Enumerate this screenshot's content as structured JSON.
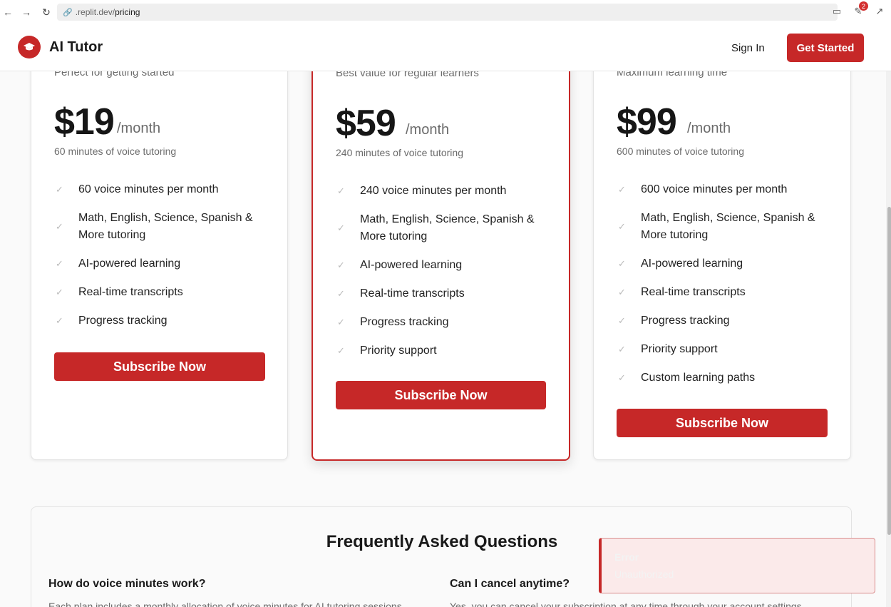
{
  "browser": {
    "url_domain": ".replit.dev/",
    "url_path": "pricing",
    "extensions_badge": "2"
  },
  "header": {
    "brand": "AI Tutor",
    "sign_in": "Sign In",
    "get_started": "Get Started"
  },
  "plans": [
    {
      "description": "Perfect for getting started",
      "price": "$19",
      "period": "/month",
      "minutes": "60 minutes of voice tutoring",
      "features": [
        "60 voice minutes per month",
        "Math, English, Science, Spanish & More tutoring",
        "AI-powered learning",
        "Real-time transcripts",
        "Progress tracking"
      ],
      "cta": "Subscribe Now"
    },
    {
      "description": "Best value for regular learners",
      "price": "$59",
      "period": "/month",
      "minutes": "240 minutes of voice tutoring",
      "features": [
        "240 voice minutes per month",
        "Math, English, Science, Spanish & More tutoring",
        "AI-powered learning",
        "Real-time transcripts",
        "Progress tracking",
        "Priority support"
      ],
      "cta": "Subscribe Now"
    },
    {
      "description": "Maximum learning time",
      "price": "$99",
      "period": "/month",
      "minutes": "600 minutes of voice tutoring",
      "features": [
        "600 voice minutes per month",
        "Math, English, Science, Spanish & More tutoring",
        "AI-powered learning",
        "Real-time transcripts",
        "Progress tracking",
        "Priority support",
        "Custom learning paths"
      ],
      "cta": "Subscribe Now"
    }
  ],
  "faq": {
    "title": "Frequently Asked Questions",
    "items": [
      {
        "question": "How do voice minutes work?",
        "answer": "Each plan includes a monthly allocation of voice minutes for AI tutoring sessions."
      },
      {
        "question": "Can I cancel anytime?",
        "answer": "Yes, you can cancel your subscription at any time through your account settings."
      }
    ]
  },
  "toast": {
    "title": "Error",
    "message": "Unauthorized"
  },
  "colors": {
    "accent": "#c62828",
    "toast_bg": "#fbeaea"
  }
}
